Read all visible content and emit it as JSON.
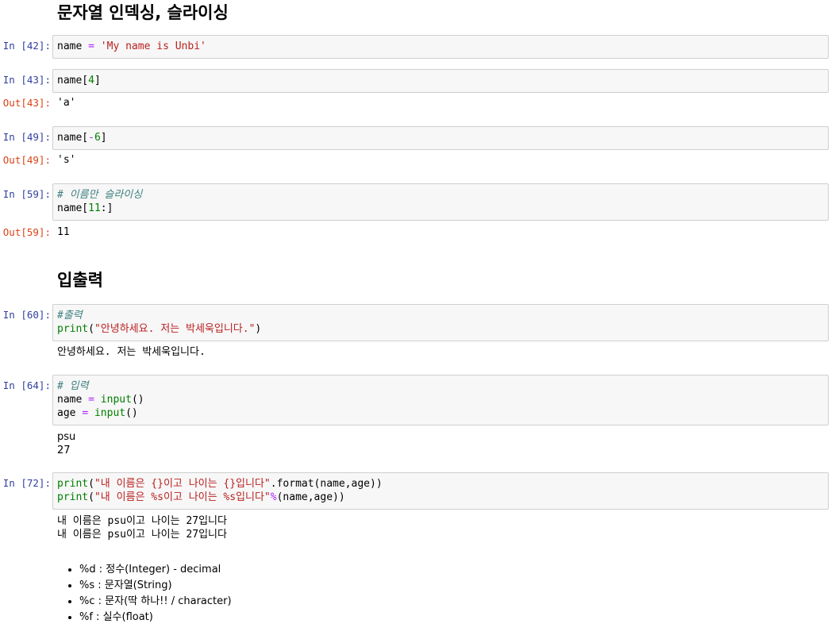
{
  "headings": {
    "indexing": "문자열 인덱싱, 슬라이싱",
    "io": "입출력"
  },
  "cells": {
    "c42": {
      "prompt": "In [42]:",
      "line1": {
        "var": "name",
        "op": "=",
        "str": "'My name is Unbi'"
      }
    },
    "c43": {
      "prompt": "In [43]:",
      "line1": {
        "pre": "name[",
        "num": "4",
        "post": "]"
      },
      "out_prompt": "Out[43]:",
      "output": "'a'"
    },
    "c49": {
      "prompt": "In [49]:",
      "line1": {
        "pre": "name[",
        "op": "-",
        "num": "6",
        "post": "]"
      },
      "out_prompt": "Out[49]:",
      "output": "'s'"
    },
    "c59": {
      "prompt": "In [59]:",
      "comment": "# 이름만 슬라이싱",
      "line2": {
        "pre": "name[",
        "num": "11",
        "post": ":]"
      },
      "out_prompt": "Out[59]:",
      "output": "11"
    },
    "c60": {
      "prompt": "In [60]:",
      "comment": "#출력",
      "line2": {
        "fn": "print",
        "open": "(",
        "str": "\"안녕하세요. 저는 박세욱입니다.\"",
        "close": ")"
      },
      "output": "안녕하세요. 저는 박세욱입니다."
    },
    "c64": {
      "prompt": "In [64]:",
      "comment": "# 입력",
      "line2": {
        "var": "name",
        "op": "=",
        "fn": "input",
        "parens": "()"
      },
      "line3": {
        "var": "age",
        "op": "=",
        "fn": "input",
        "parens": "()"
      },
      "output1": "psu",
      "output2": "27"
    },
    "c72": {
      "prompt": "In [72]:",
      "line1": {
        "fn": "print",
        "open": "(",
        "str": "\"내 이름은 {}이고 나이는 {}입니다\"",
        "rest": ".format(name,age))"
      },
      "line2": {
        "fn": "print",
        "open": "(",
        "str": "\"내 이름은 %s이고 나이는 %s입니다\"",
        "op": "%",
        "rest": "(name,age))"
      },
      "output1": "내 이름은 psu이고 나이는 27입니다",
      "output2": "내 이름은 psu이고 나이는 27입니다"
    }
  },
  "format_list": [
    "%d : 정수(Integer) - decimal",
    "%s : 문자열(String)",
    "%c : 문자(딱 하나!! / character)",
    "%f : 실수(float)"
  ]
}
